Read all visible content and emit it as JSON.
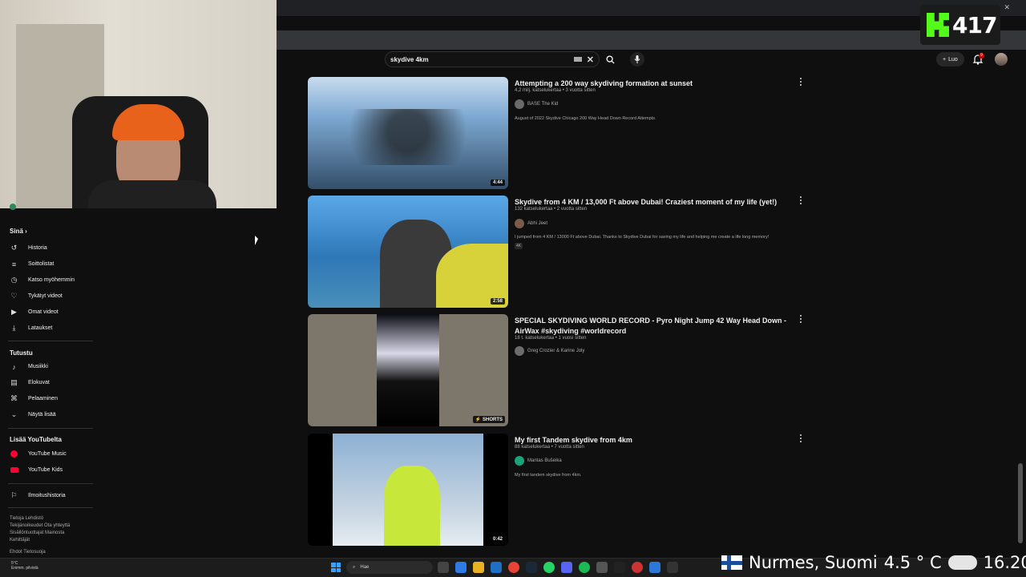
{
  "overlay": {
    "kick_count": "417",
    "location": "Nurmes, Suomi",
    "temperature": "4.5 ° C",
    "clock": "16.20"
  },
  "search": {
    "query": "skydive 4km"
  },
  "header": {
    "create_label": "Luo",
    "notif_count": "9"
  },
  "sidebar": {
    "you_heading": "Sinä",
    "you_items": [
      {
        "label": "Historia",
        "icon": "history-icon"
      },
      {
        "label": "Soittolistat",
        "icon": "playlist-icon"
      },
      {
        "label": "Katso myöhemmin",
        "icon": "clock-icon"
      },
      {
        "label": "Tykätyt videot",
        "icon": "thumbs-up-icon"
      },
      {
        "label": "Omat videot",
        "icon": "video-icon"
      },
      {
        "label": "Lataukset",
        "icon": "download-icon"
      }
    ],
    "explore_heading": "Tutustu",
    "explore_items": [
      {
        "label": "Musiikki",
        "icon": "music-icon"
      },
      {
        "label": "Elokuvat",
        "icon": "film-icon"
      },
      {
        "label": "Pelaaminen",
        "icon": "gamepad-icon"
      },
      {
        "label": "Näytä lisää",
        "icon": "chevron-down-icon"
      }
    ],
    "more_heading": "Lisää YouTubelta",
    "more_items": [
      {
        "label": "YouTube Music",
        "icon": "youtube-music-icon"
      },
      {
        "label": "YouTube Kids",
        "icon": "youtube-kids-icon"
      }
    ],
    "report_label": "Ilmoitushistoria",
    "footer_1": "Tietoja  Lehdistö",
    "footer_2": "Tekijänoikeudet  Ota yhteyttä",
    "footer_3": "Sisällöntuottajat  Mainosta",
    "footer_4": "Kehittäjät",
    "footer_5": "Ehdot  Tietosuoja"
  },
  "videos": [
    {
      "title": "Attempting a 200 way skydiving formation at sunset",
      "meta": "4,2 milj. katselukertaa • 3 vuotta sitten",
      "channel": "BASE The Kid",
      "description": "August of 2022 Skydive Chicago 200 Way Head Down Record Attempts.",
      "duration": "4:44",
      "colors": {
        "top": "#9cc4e8",
        "bottom": "#2a4d6e",
        "avatar": "#6a6a6a"
      }
    },
    {
      "title": "Skydive from 4 KM / 13,000 Ft above Dubai! Craziest moment of my life (yet!)",
      "meta": "132 katselukertaa • 2 vuotta sitten",
      "channel": "Abhi Jeet",
      "description": "I jumped from 4 KM / 13000 Ft above Dubai. Thanks to Skydive Dubai for saving my life and helping me create a life long memory!",
      "badge": "4K",
      "duration": "2:58",
      "colors": {
        "top": "#3d8fd8",
        "bottom": "#d8c84a",
        "avatar": "#7a5a4a"
      }
    },
    {
      "title": "SPECIAL SKYDIVING WORLD RECORD - Pyro Night Jump 42 Way Head Down - AirWax #skydiving #worldrecord",
      "meta": "18 t. katselukertaa • 1 vuosi sitten",
      "channel": "Greg Crozier & Karine Joly",
      "duration": "SHORTS",
      "colors": {
        "top": "#8a8273",
        "bottom": "#6f685c",
        "avatar": "#6c6c6c"
      }
    },
    {
      "title": "My first Tandem skydive from 4km",
      "meta": "88 katselukertaa • 7 vuotta sitten",
      "channel": "Mantas Bušeika",
      "description": "My first tandem skydive from 4km.",
      "duration": "0:42",
      "colors": {
        "top": "#7fa3c8",
        "bottom": "#d2dbe4",
        "avatar": "#1aa37a"
      }
    }
  ],
  "taskbar": {
    "weather_temp": "5°C",
    "weather_desc": "Enimm. pilvistä",
    "search_placeholder": "Hae"
  }
}
